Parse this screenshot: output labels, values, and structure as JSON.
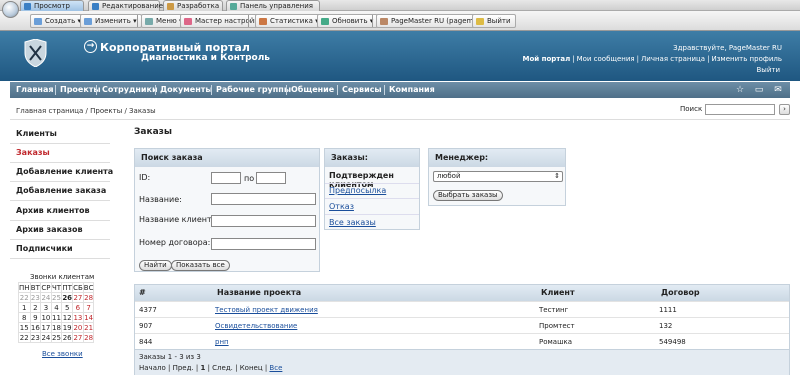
{
  "browser": {
    "tabs": [
      "Просмотр",
      "Редактирование",
      "Разработка",
      "Панель управления"
    ],
    "toolbar": {
      "create": "Создать",
      "change": "Изменить",
      "menu": "Меню",
      "wizard": "Мастер настройки",
      "stats": "Статистика",
      "refresh": "Обновить",
      "user": "PageMaster RU (pagemaster)",
      "logout": "Выйти"
    }
  },
  "header": {
    "title": "Корпоративный портал",
    "subtitle": "Диагностика и Контроль",
    "greeting": "Здравствуйте, PageMaster RU",
    "links": [
      "Мой портал",
      "Мои сообщения",
      "Личная страница",
      "Изменить профиль"
    ],
    "logout": "Выйти"
  },
  "nav": {
    "items": [
      "Главная",
      "Проекты",
      "Сотрудники",
      "Документы",
      "Рабочие группы",
      "Общение",
      "Сервисы",
      "Компания"
    ],
    "icons": [
      "star-icon",
      "print-icon",
      "mail-icon"
    ]
  },
  "breadcrumb": "Главная страница / Проекты / Заказы",
  "search": {
    "label": "Поиск",
    "go": "›"
  },
  "sidebar": {
    "items": [
      "Клиенты",
      "Заказы",
      "Добавление клиента",
      "Добавление заказа",
      "Архив клиентов",
      "Архив заказов",
      "Подписчики"
    ],
    "selected": 1
  },
  "calendar": {
    "title": "Звонки клиентам",
    "days": [
      "ПН",
      "ВТ",
      "СР",
      "ЧТ",
      "ПТ",
      "СБ",
      "ВС"
    ],
    "weeks": [
      [
        "22",
        "23",
        "24",
        "25",
        "26",
        "27",
        "28"
      ],
      [
        "1",
        "2",
        "3",
        "4",
        "5",
        "6",
        "7"
      ],
      [
        "8",
        "9",
        "10",
        "11",
        "12",
        "13",
        "14"
      ],
      [
        "15",
        "16",
        "17",
        "18",
        "19",
        "20",
        "21"
      ],
      [
        "22",
        "23",
        "24",
        "25",
        "26",
        "27",
        "28"
      ]
    ],
    "link": "Все звонки"
  },
  "page_title": "Заказы",
  "search_box": {
    "title": "Поиск заказа",
    "id_label": "ID:",
    "to_label": "по",
    "name_label": "Название:",
    "client_label": "Название клиента:",
    "contract_label": "Номер договора:",
    "find": "Найти",
    "show_all": "Показать все"
  },
  "orders_box": {
    "title": "Заказы:",
    "items": [
      "Подтвержден клиентом",
      "Предпосылка",
      "Отказ",
      "Все заказы"
    ]
  },
  "manager_box": {
    "title": "Менеджер:",
    "selected": "любой",
    "button": "Выбрать заказы"
  },
  "table": {
    "columns": [
      "#",
      "Название проекта",
      "Клиент",
      "Договор"
    ],
    "rows": [
      [
        "4377",
        "Тестовый проект движения",
        "Тестинг",
        "1111"
      ],
      [
        "907",
        "Освидетельствование",
        "Промтест",
        "132"
      ],
      [
        "844",
        "рнп",
        "Ромашка",
        "549498"
      ]
    ],
    "summary": "Заказы 1 - 3 из 3",
    "pager": {
      "start": "Начало",
      "prev": "Пред.",
      "page": "1",
      "next": "След.",
      "end": "Конец",
      "all": "Все"
    }
  }
}
